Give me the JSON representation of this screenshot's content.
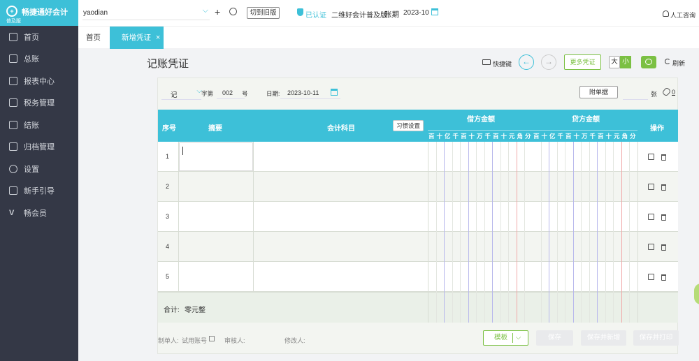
{
  "app": {
    "name": "畅捷通好会计",
    "edition": "普及版"
  },
  "sidebar": {
    "items": [
      {
        "label": "首页",
        "icon": "home-icon"
      },
      {
        "label": "总账",
        "icon": "ledger-icon"
      },
      {
        "label": "报表中心",
        "icon": "chart-icon"
      },
      {
        "label": "税务管理",
        "icon": "tax-icon"
      },
      {
        "label": "结账",
        "icon": "closing-icon"
      },
      {
        "label": "归档管理",
        "icon": "archive-icon"
      },
      {
        "label": "设置",
        "icon": "gear-icon"
      },
      {
        "label": "新手引导",
        "icon": "play-icon"
      },
      {
        "label": "畅会员",
        "icon": "vip-icon"
      }
    ]
  },
  "topbar": {
    "company": "yaodian",
    "switch_old": "切到旧版",
    "certified": "已认证",
    "qr_edition": "二维好会计普及版",
    "period_label": "账期",
    "period": "2023-10",
    "support": "人工咨询"
  },
  "tabs": {
    "home": "首页",
    "new_voucher": "新增凭证",
    "close": "×"
  },
  "voucher": {
    "title": "记账凭证",
    "shortcut": "快捷键",
    "more": "更多凭证",
    "size_large": "大",
    "size_small": "小",
    "refresh": "刷新",
    "word": "记",
    "word_suffix": "字第",
    "number": "002",
    "number_suffix": "号",
    "date_label": "日期:",
    "date": "2023-10-11",
    "attachment": "附单据",
    "attachment_unit": "张",
    "attachment_count": "0",
    "headers": {
      "seq": "序号",
      "summary": "摘要",
      "subject": "会计科目",
      "habit": "习惯设置",
      "debit": "借方金额",
      "credit": "贷方金额",
      "ops": "操作"
    },
    "digit_units": [
      "百",
      "十",
      "亿",
      "千",
      "百",
      "十",
      "万",
      "千",
      "百",
      "十",
      "元",
      "角",
      "分"
    ],
    "rows": [
      "1",
      "2",
      "3",
      "4",
      "5"
    ],
    "total_label": "合计:",
    "total_value": "零元整",
    "footer": {
      "maker_label": "制单人:",
      "maker": "试用账号",
      "auditor_label": "审核人:",
      "auditor": "",
      "modifier_label": "修改人:",
      "modifier": ""
    },
    "buttons": {
      "template": "模板",
      "save": "保存",
      "save_new": "保存并新增",
      "save_print": "保存并打印"
    }
  },
  "colors": {
    "sidebar": "#343846",
    "accent": "#3dc0d8",
    "green": "#7bc043"
  }
}
